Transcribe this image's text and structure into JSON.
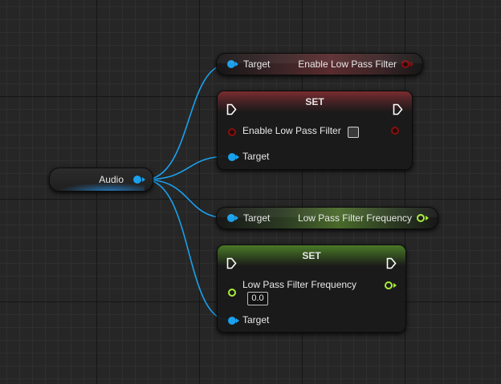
{
  "audio_node": {
    "label": "Audio"
  },
  "get_enable_node": {
    "target_label": "Target",
    "output_label": "Enable Low Pass Filter"
  },
  "set_enable_node": {
    "title": "SET",
    "input_label": "Enable Low Pass Filter",
    "target_label": "Target",
    "checkbox_checked": false
  },
  "get_frequency_node": {
    "target_label": "Target",
    "output_label": "Low Pass Filter Frequency"
  },
  "set_frequency_node": {
    "title": "SET",
    "input_label": "Low Pass Filter Frequency",
    "input_value": "0.0",
    "target_label": "Target"
  },
  "colors": {
    "object_pin": "#19a1ee",
    "bool_pin": "#8a0f0f",
    "float_pin": "#a8ee3b",
    "set_bool_header": "#7a2c30",
    "set_float_header": "#4a7a28"
  }
}
